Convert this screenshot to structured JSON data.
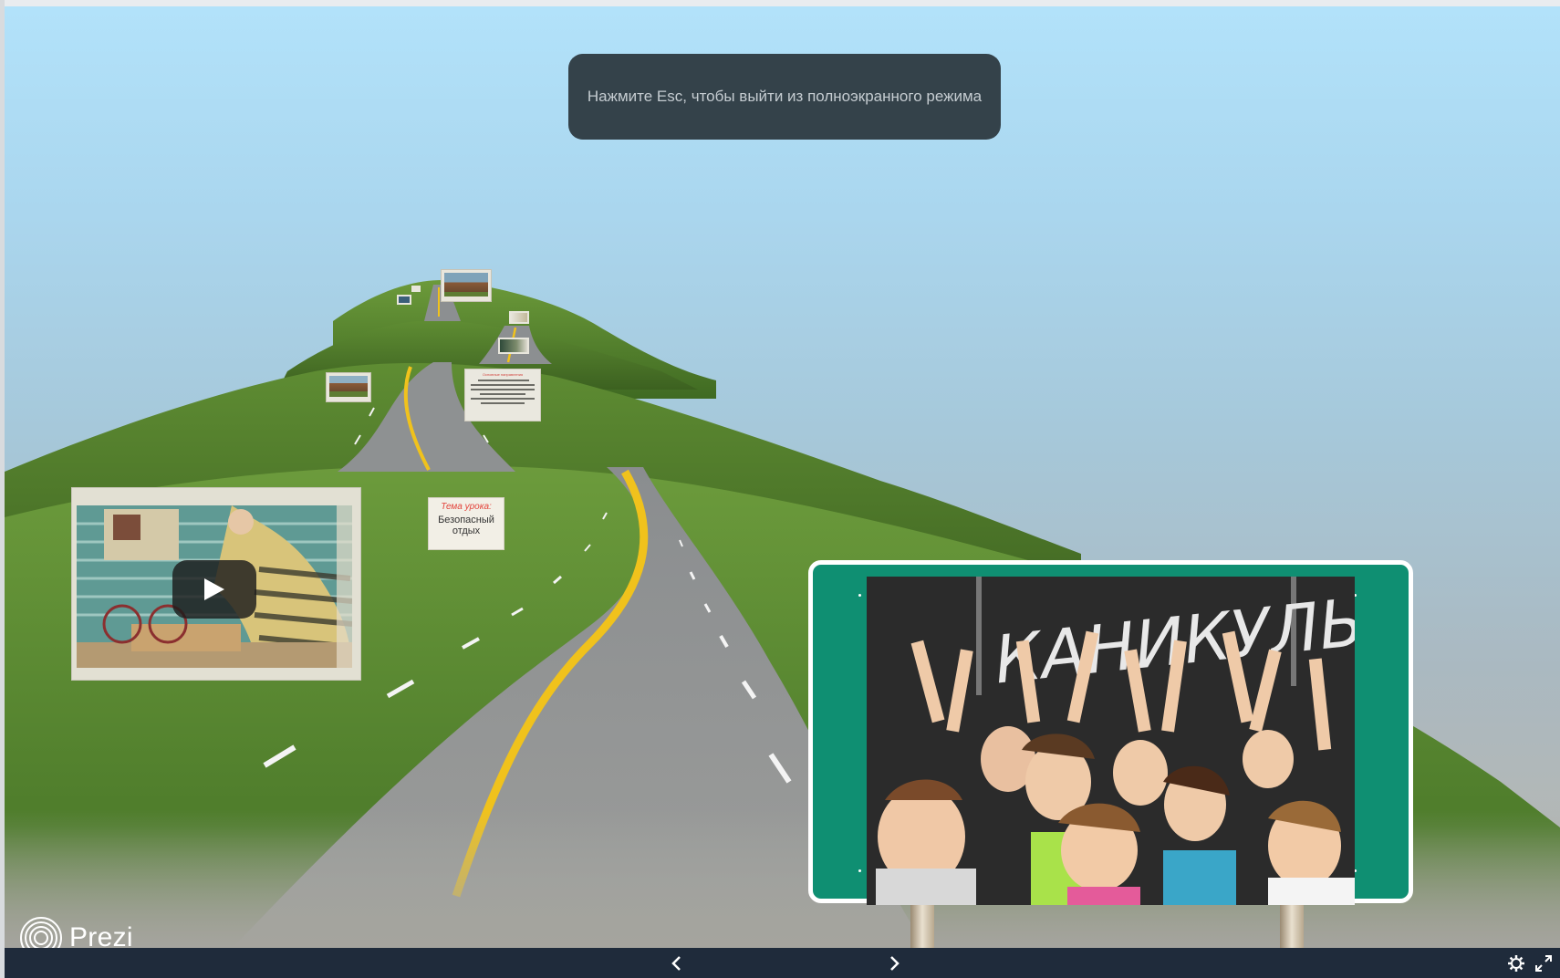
{
  "fullscreen_toast": {
    "message": "Нажмите Esc, чтобы выйти из полноэкранного режима"
  },
  "topic_card": {
    "title": "Тема урока:",
    "text": "Безопасный отдых"
  },
  "info_card": {
    "title": "Основные направления"
  },
  "billboard": {
    "photo": "Ученики с поднятыми руками у доски с надписью «КАНИКУЛЫ!»",
    "chalk_text": "КАНИКУЛЫ!"
  },
  "video": {
    "play_icon": "play-icon"
  },
  "branding": {
    "logo_text": "Prezi"
  },
  "controls": {
    "prev_icon": "chevron-left-icon",
    "next_icon": "chevron-right-icon",
    "settings_icon": "gear-icon",
    "fullscreen_icon": "exit-fullscreen-icon"
  },
  "colors": {
    "bottom_bar": "#1f2b3b",
    "toast_bg": "#34424a",
    "billboard_green": "#0f8f72",
    "road_line": "#f0c21c"
  }
}
